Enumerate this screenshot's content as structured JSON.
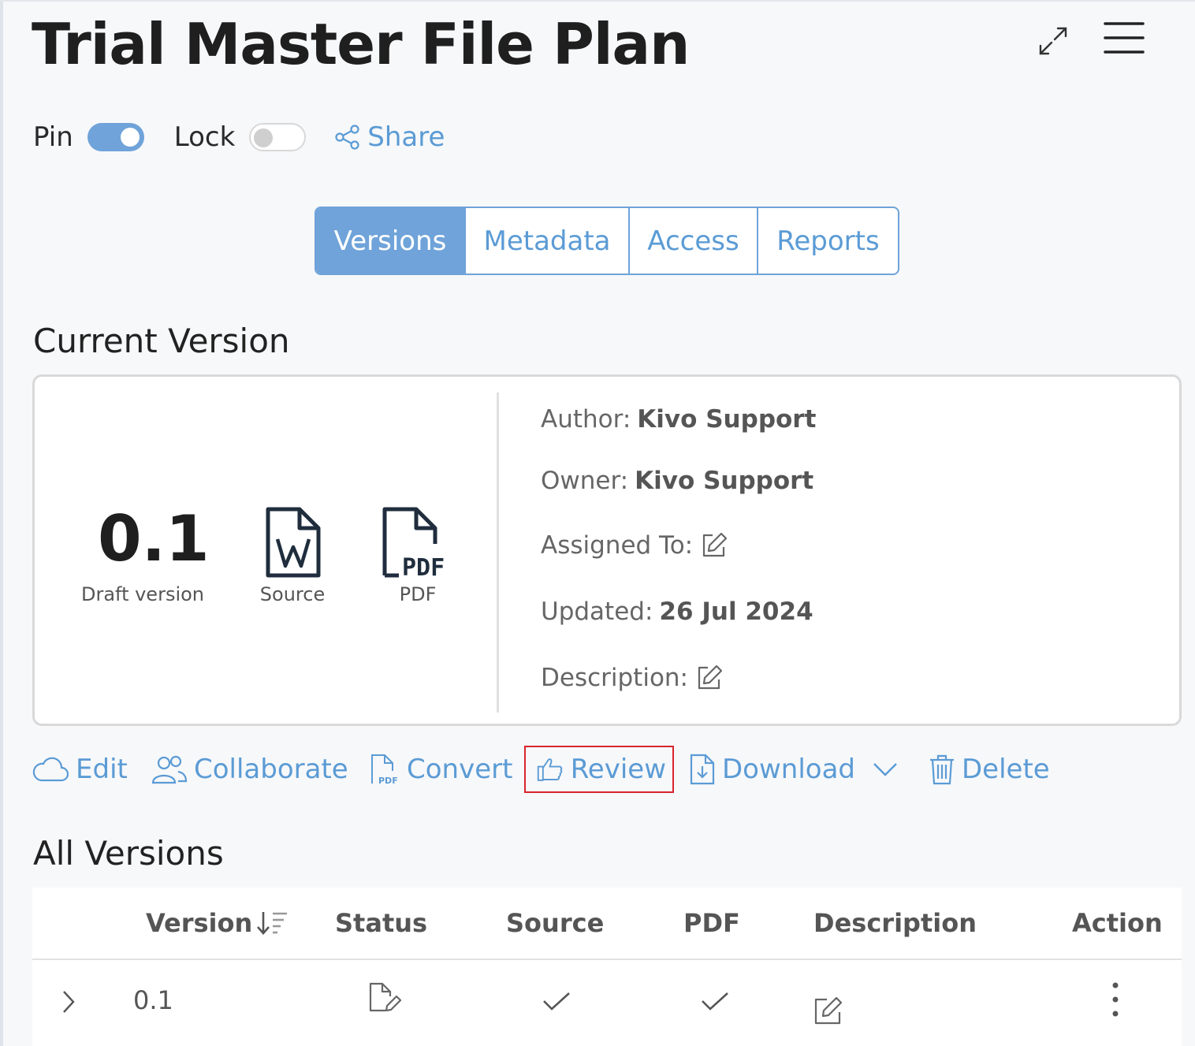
{
  "header": {
    "title": "Trial Master File Plan"
  },
  "toolbar": {
    "pin_label": "Pin",
    "pin_on": true,
    "lock_label": "Lock",
    "lock_on": false,
    "share_label": "Share"
  },
  "tabs": [
    {
      "label": "Versions",
      "active": true
    },
    {
      "label": "Metadata",
      "active": false
    },
    {
      "label": "Access",
      "active": false
    },
    {
      "label": "Reports",
      "active": false
    }
  ],
  "current_version": {
    "heading": "Current Version",
    "number": "0.1",
    "number_label": "Draft version",
    "source_label": "Source",
    "pdf_label": "PDF",
    "pdf_icon_text": "PDF",
    "author_label": "Author:",
    "author_value": "Kivo Support",
    "owner_label": "Owner:",
    "owner_value": "Kivo Support",
    "assigned_label": "Assigned To:",
    "updated_label": "Updated:",
    "updated_value": "26 Jul 2024",
    "description_label": "Description:"
  },
  "actions": {
    "edit": "Edit",
    "collaborate": "Collaborate",
    "convert": "Convert",
    "review": "Review",
    "download": "Download",
    "delete": "Delete"
  },
  "all_versions": {
    "heading": "All Versions",
    "columns": [
      "Version",
      "Status",
      "Source",
      "PDF",
      "Description",
      "Action"
    ],
    "rows": [
      {
        "version": "0.1",
        "status_icon": "draft-edit-icon",
        "source": true,
        "pdf": true
      }
    ]
  },
  "colors": {
    "accent": "#5b9bd5",
    "accent_fill": "#6fa3d9",
    "highlight": "#d9242c"
  }
}
